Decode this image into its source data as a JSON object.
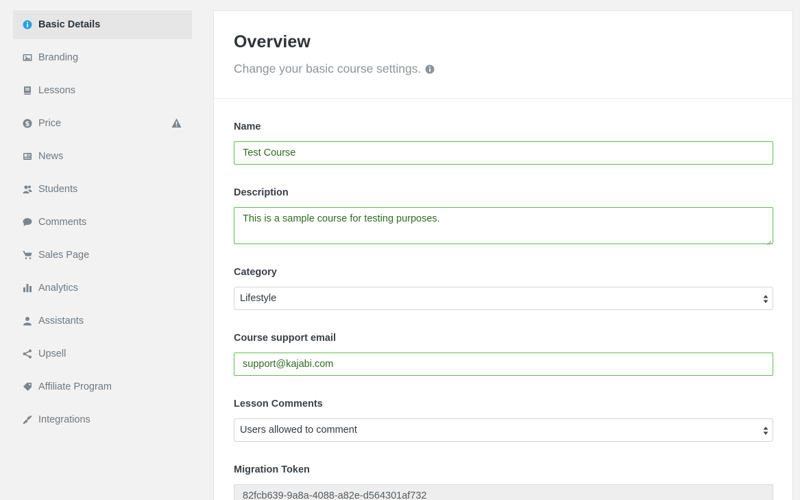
{
  "sidebar": {
    "items": [
      {
        "label": "Basic Details",
        "icon": "info-circle-icon",
        "active": true
      },
      {
        "label": "Branding",
        "icon": "image-icon"
      },
      {
        "label": "Lessons",
        "icon": "book-icon"
      },
      {
        "label": "Price",
        "icon": "dollar-circle-icon",
        "warning": true
      },
      {
        "label": "News",
        "icon": "newspaper-icon"
      },
      {
        "label": "Students",
        "icon": "students-icon"
      },
      {
        "label": "Comments",
        "icon": "comment-icon"
      },
      {
        "label": "Sales Page",
        "icon": "cart-icon"
      },
      {
        "label": "Analytics",
        "icon": "bar-chart-icon"
      },
      {
        "label": "Assistants",
        "icon": "user-icon"
      },
      {
        "label": "Upsell",
        "icon": "share-icon"
      },
      {
        "label": "Affiliate Program",
        "icon": "tag-icon"
      },
      {
        "label": "Integrations",
        "icon": "link-icon"
      }
    ]
  },
  "header": {
    "title": "Overview",
    "subtitle": "Change your basic course settings."
  },
  "form": {
    "name": {
      "label": "Name",
      "value": "Test Course"
    },
    "description": {
      "label": "Description",
      "value": "This is a sample course for testing purposes."
    },
    "category": {
      "label": "Category",
      "value": "Lifestyle"
    },
    "support_email": {
      "label": "Course support email",
      "value": "support@kajabi.com"
    },
    "lesson_comments": {
      "label": "Lesson Comments",
      "value": "Users allowed to comment"
    },
    "migration_token": {
      "label": "Migration Token",
      "value": "82fcb639-9a8a-4088-a82e-d564301af732"
    }
  },
  "colors": {
    "active_icon": "#2aa3e0",
    "valid_border": "#5ebd4f",
    "valid_text": "#2f6b1f",
    "warning_icon": "#7d858c"
  }
}
